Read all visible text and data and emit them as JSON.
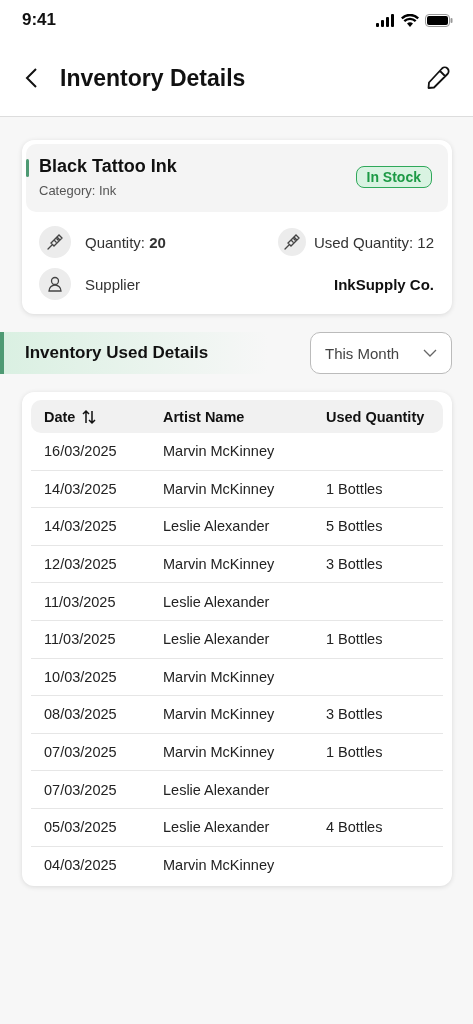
{
  "status_bar": {
    "time": "9:41"
  },
  "header": {
    "title": "Inventory Details"
  },
  "item": {
    "name": "Black Tattoo Ink",
    "category": "Category: Ink",
    "status": {
      "label": "In Stock",
      "kind": "in_stock"
    },
    "quantity": "Quantity: **20**",
    "used_quantity": "Used Quantity: 12",
    "supplier_label": "Supplier",
    "supplier": "InkSupply Co."
  },
  "section": {
    "title": "Inventory Used Details",
    "filter": "This Month"
  },
  "table": {
    "columns": [
      {
        "label": "Date",
        "sortable": true
      },
      {
        "label": "Artist Name",
        "sortable": false
      },
      {
        "label": "Used Quantity",
        "sortable": false
      }
    ],
    "rows": [
      {
        "date": "16/03/2025",
        "artist": "Marvin McKinney"
      },
      {
        "date": "14/03/2025",
        "artist": "Marvin McKinney",
        "quantity": "1 Bottles"
      },
      {
        "date": "14/03/2025",
        "artist": "Leslie Alexander",
        "quantity": "5 Bottles"
      },
      {
        "date": "12/03/2025",
        "artist": "Marvin McKinney",
        "quantity": "3 Bottles"
      },
      {
        "date": "11/03/2025",
        "artist": "Leslie Alexander"
      },
      {
        "date": "11/03/2025",
        "artist": "Leslie Alexander",
        "quantity": "1 Bottles"
      },
      {
        "date": "10/03/2025",
        "artist": "Marvin McKinney"
      },
      {
        "date": "08/03/2025",
        "artist": "Marvin McKinney",
        "quantity": "3 Bottles"
      },
      {
        "date": "07/03/2025",
        "artist": "Marvin McKinney",
        "quantity": "1 Bottles"
      },
      {
        "date": "07/03/2025",
        "artist": "Leslie Alexander"
      },
      {
        "date": "05/03/2025",
        "artist": "Leslie Alexander",
        "quantity": "4 Bottles"
      },
      {
        "date": "04/03/2025",
        "artist": "Marvin McKinney"
      }
    ]
  }
}
